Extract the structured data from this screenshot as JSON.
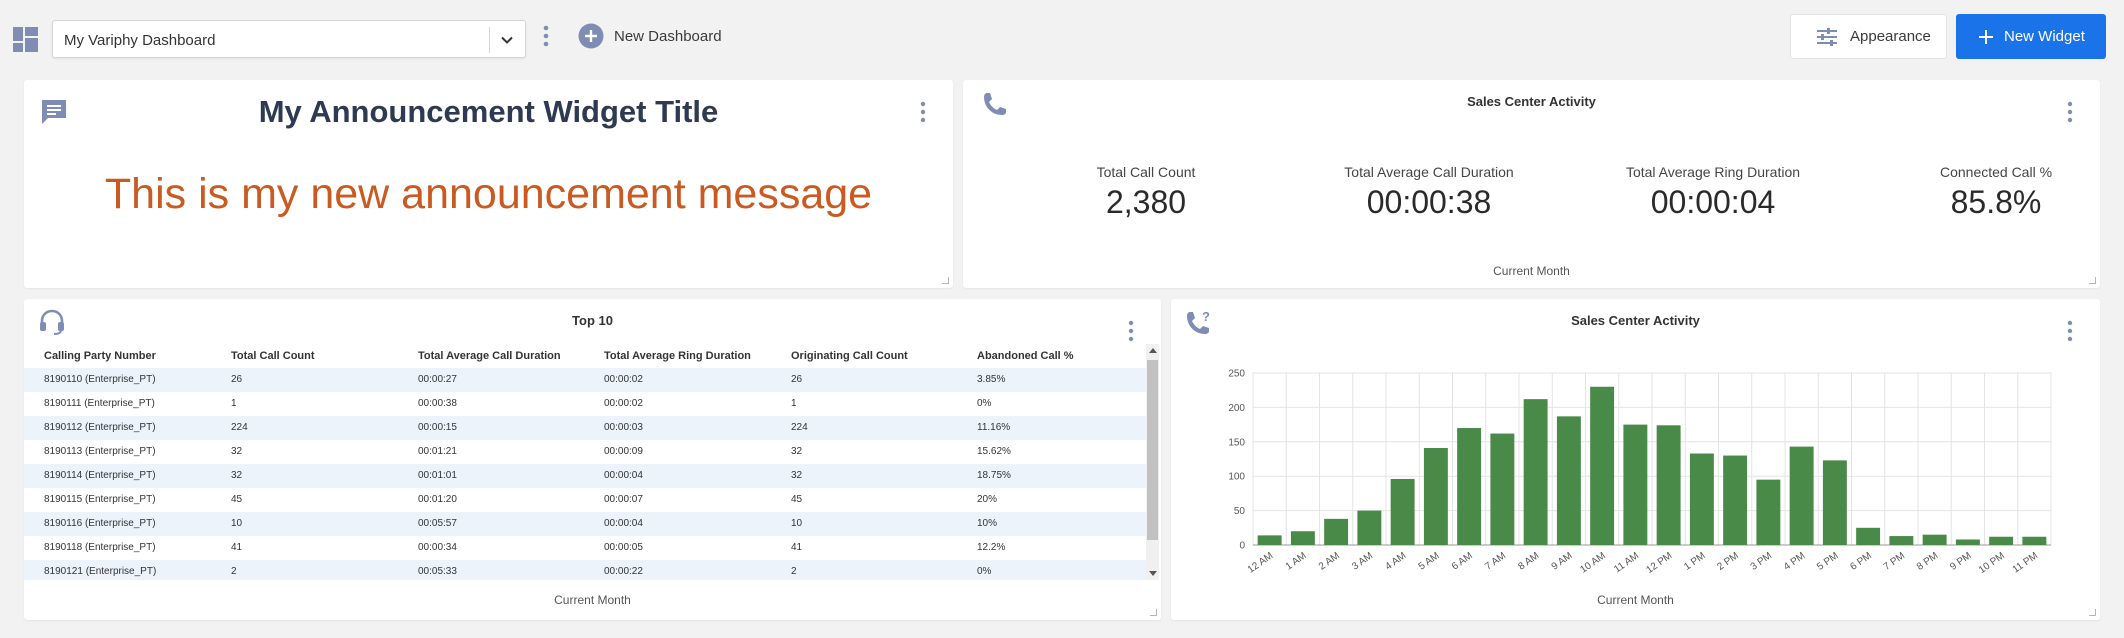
{
  "topbar": {
    "dashboard_select_value": "My Variphy Dashboard",
    "new_dashboard_label": "New Dashboard",
    "appearance_label": "Appearance",
    "new_widget_label": "New Widget"
  },
  "colors": {
    "accent": "#1a73e8",
    "icon": "#7f8db5",
    "announcement": "#c85a22",
    "bar": "#4a8a49"
  },
  "announcement": {
    "title": "My Announcement Widget Title",
    "message": "This is my new announcement message"
  },
  "kpi_widget": {
    "title": "Sales Center Activity",
    "footer": "Current Month",
    "kpis": [
      {
        "label": "Total Call Count",
        "value": "2,380"
      },
      {
        "label": "Total Average Call Duration",
        "value": "00:00:38"
      },
      {
        "label": "Total Average Ring Duration",
        "value": "00:00:04"
      },
      {
        "label": "Connected Call %",
        "value": "85.8%"
      }
    ]
  },
  "table_widget": {
    "title": "Top 10",
    "footer": "Current Month",
    "columns": [
      "Calling Party Number",
      "Total Call Count",
      "Total Average Call Duration",
      "Total Average Ring Duration",
      "Originating Call Count",
      "Abandoned Call %"
    ],
    "rows": [
      [
        "8190110 (Enterprise_PT)",
        "26",
        "00:00:27",
        "00:00:02",
        "26",
        "3.85%"
      ],
      [
        "8190111 (Enterprise_PT)",
        "1",
        "00:00:38",
        "00:00:02",
        "1",
        "0%"
      ],
      [
        "8190112 (Enterprise_PT)",
        "224",
        "00:00:15",
        "00:00:03",
        "224",
        "11.16%"
      ],
      [
        "8190113 (Enterprise_PT)",
        "32",
        "00:01:21",
        "00:00:09",
        "32",
        "15.62%"
      ],
      [
        "8190114 (Enterprise_PT)",
        "32",
        "00:01:01",
        "00:00:04",
        "32",
        "18.75%"
      ],
      [
        "8190115 (Enterprise_PT)",
        "45",
        "00:01:20",
        "00:00:07",
        "45",
        "20%"
      ],
      [
        "8190116 (Enterprise_PT)",
        "10",
        "00:05:57",
        "00:00:04",
        "10",
        "10%"
      ],
      [
        "8190118 (Enterprise_PT)",
        "41",
        "00:00:34",
        "00:00:05",
        "41",
        "12.2%"
      ],
      [
        "8190121 (Enterprise_PT)",
        "2",
        "00:05:33",
        "00:00:22",
        "2",
        "0%"
      ]
    ]
  },
  "chart_widget": {
    "title": "Sales Center Activity",
    "footer": "Current Month"
  },
  "chart_data": {
    "type": "bar",
    "title": "Sales Center Activity",
    "xlabel": "",
    "ylabel": "",
    "categories": [
      "12 AM",
      "1 AM",
      "2 AM",
      "3 AM",
      "4 AM",
      "5 AM",
      "6 AM",
      "7 AM",
      "8 AM",
      "9 AM",
      "10 AM",
      "11 AM",
      "12 PM",
      "1 PM",
      "2 PM",
      "3 PM",
      "4 PM",
      "5 PM",
      "6 PM",
      "7 PM",
      "8 PM",
      "9 PM",
      "10 PM",
      "11 PM"
    ],
    "values": [
      14,
      20,
      38,
      50,
      96,
      141,
      170,
      162,
      212,
      187,
      230,
      175,
      174,
      133,
      130,
      95,
      143,
      123,
      25,
      13,
      15,
      8,
      12,
      12
    ],
    "ylim": [
      0,
      250
    ],
    "yticks": [
      0,
      50,
      100,
      150,
      200,
      250
    ],
    "grid": true
  }
}
